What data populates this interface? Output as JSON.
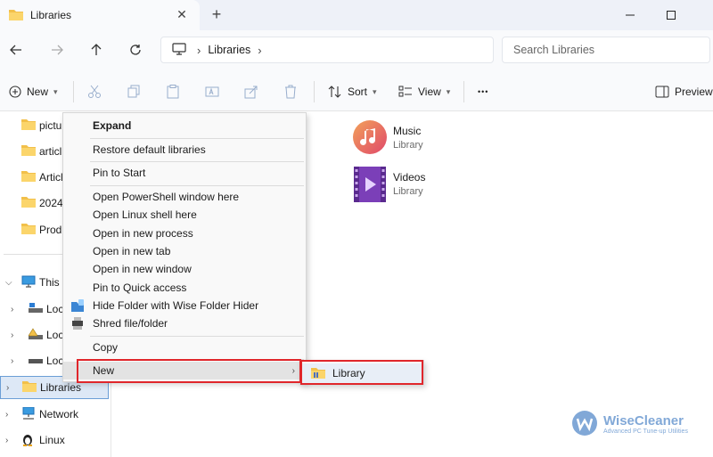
{
  "window": {
    "tab_title": "Libraries",
    "new_tab": "+"
  },
  "address": {
    "breadcrumb": [
      "Libraries"
    ],
    "search_placeholder": "Search Libraries"
  },
  "toolbar": {
    "new_label": "New",
    "sort_label": "Sort",
    "view_label": "View",
    "more_label": "•••",
    "preview_label": "Preview"
  },
  "nav_pane": {
    "quick_items": [
      "pictu",
      "articl",
      "Articl",
      "2024-",
      "Produ"
    ],
    "this_pc": "This P",
    "drives": [
      "Loc",
      "Loc",
      "Loc"
    ],
    "libraries": "Libraries",
    "network": "Network",
    "linux": "Linux"
  },
  "content": {
    "items": [
      {
        "name": "Music",
        "type": "Library",
        "icon": "music-library-icon"
      },
      {
        "name": "Videos",
        "type": "Library",
        "icon": "videos-library-icon"
      }
    ]
  },
  "context_menu": {
    "expand": "Expand",
    "restore": "Restore default libraries",
    "pin_start": "Pin to Start",
    "powershell": "Open PowerShell window here",
    "linux_shell": "Open Linux shell here",
    "new_process": "Open in new process",
    "new_tab": "Open in new tab",
    "new_window": "Open in new window",
    "quick_access": "Pin to Quick access",
    "hide_folder": "Hide Folder with Wise Folder Hider",
    "shred": "Shred file/folder",
    "copy": "Copy",
    "new": "New"
  },
  "submenu": {
    "library": "Library"
  },
  "watermark": {
    "brand": "WiseCleaner",
    "tagline": "Advanced PC Tune-up Utilities"
  },
  "colors": {
    "highlight_box": "#e0262b",
    "selected_nav": "#dde8f6",
    "accent": "#0067c0"
  }
}
